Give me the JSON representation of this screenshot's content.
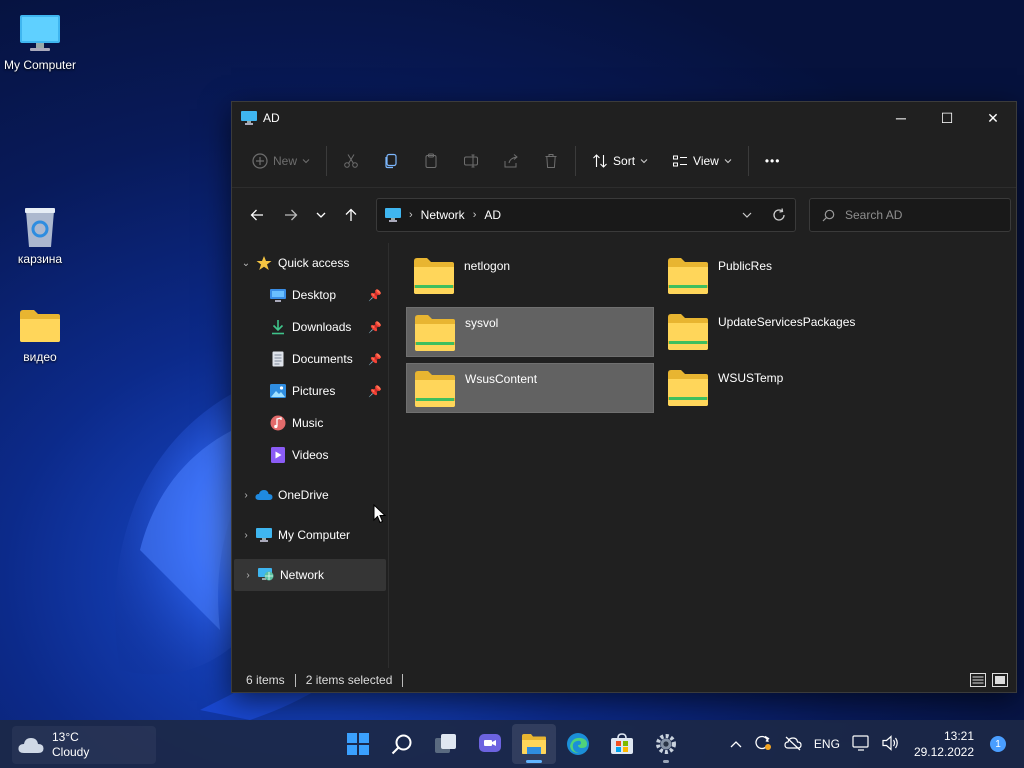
{
  "desktop": {
    "icons": [
      {
        "label": "My Computer",
        "icon": "monitor-icon"
      },
      {
        "label": "карзина",
        "icon": "recycle-bin-icon"
      },
      {
        "label": "видео",
        "icon": "folder-icon"
      }
    ]
  },
  "window": {
    "title": "AD",
    "controls": {
      "minimize": "─",
      "maximize": "☐",
      "close": "✕"
    }
  },
  "command_bar": {
    "new_label": "New",
    "sort_label": "Sort",
    "view_label": "View",
    "more_label": "•••"
  },
  "address": {
    "crumbs": [
      "Network",
      "AD"
    ]
  },
  "search": {
    "placeholder": "Search AD"
  },
  "sidebar": {
    "quick_access": "Quick access",
    "pinned": [
      {
        "label": "Desktop",
        "pinned": true
      },
      {
        "label": "Downloads",
        "pinned": true
      },
      {
        "label": "Documents",
        "pinned": true
      },
      {
        "label": "Pictures",
        "pinned": true
      },
      {
        "label": "Music",
        "pinned": false
      },
      {
        "label": "Videos",
        "pinned": false
      }
    ],
    "roots": [
      {
        "label": "OneDrive"
      },
      {
        "label": "My Computer"
      },
      {
        "label": "Network"
      }
    ],
    "selected": "Network"
  },
  "files": [
    {
      "name": "netlogon",
      "selected": false
    },
    {
      "name": "PublicRes",
      "selected": false
    },
    {
      "name": "sysvol",
      "selected": true
    },
    {
      "name": "UpdateServicesPackages",
      "selected": false
    },
    {
      "name": "WsusContent",
      "selected": true
    },
    {
      "name": "WSUSTemp",
      "selected": false
    }
  ],
  "status": {
    "count": "6 items",
    "selected": "2 items selected"
  },
  "taskbar": {
    "weather": {
      "temp": "13°C",
      "condition": "Cloudy"
    },
    "apps": [
      "start-icon",
      "search-icon",
      "task-view-icon",
      "chat-icon",
      "file-explorer-icon",
      "edge-icon",
      "store-icon",
      "settings-icon"
    ],
    "language": "ENG",
    "time": "13:21",
    "date": "29.12.2022",
    "notifications": "1"
  },
  "colors": {
    "accent": "#60b4ff",
    "folder_yellow": "#f5c542",
    "window_bg": "#202020",
    "selection": "#626262"
  }
}
